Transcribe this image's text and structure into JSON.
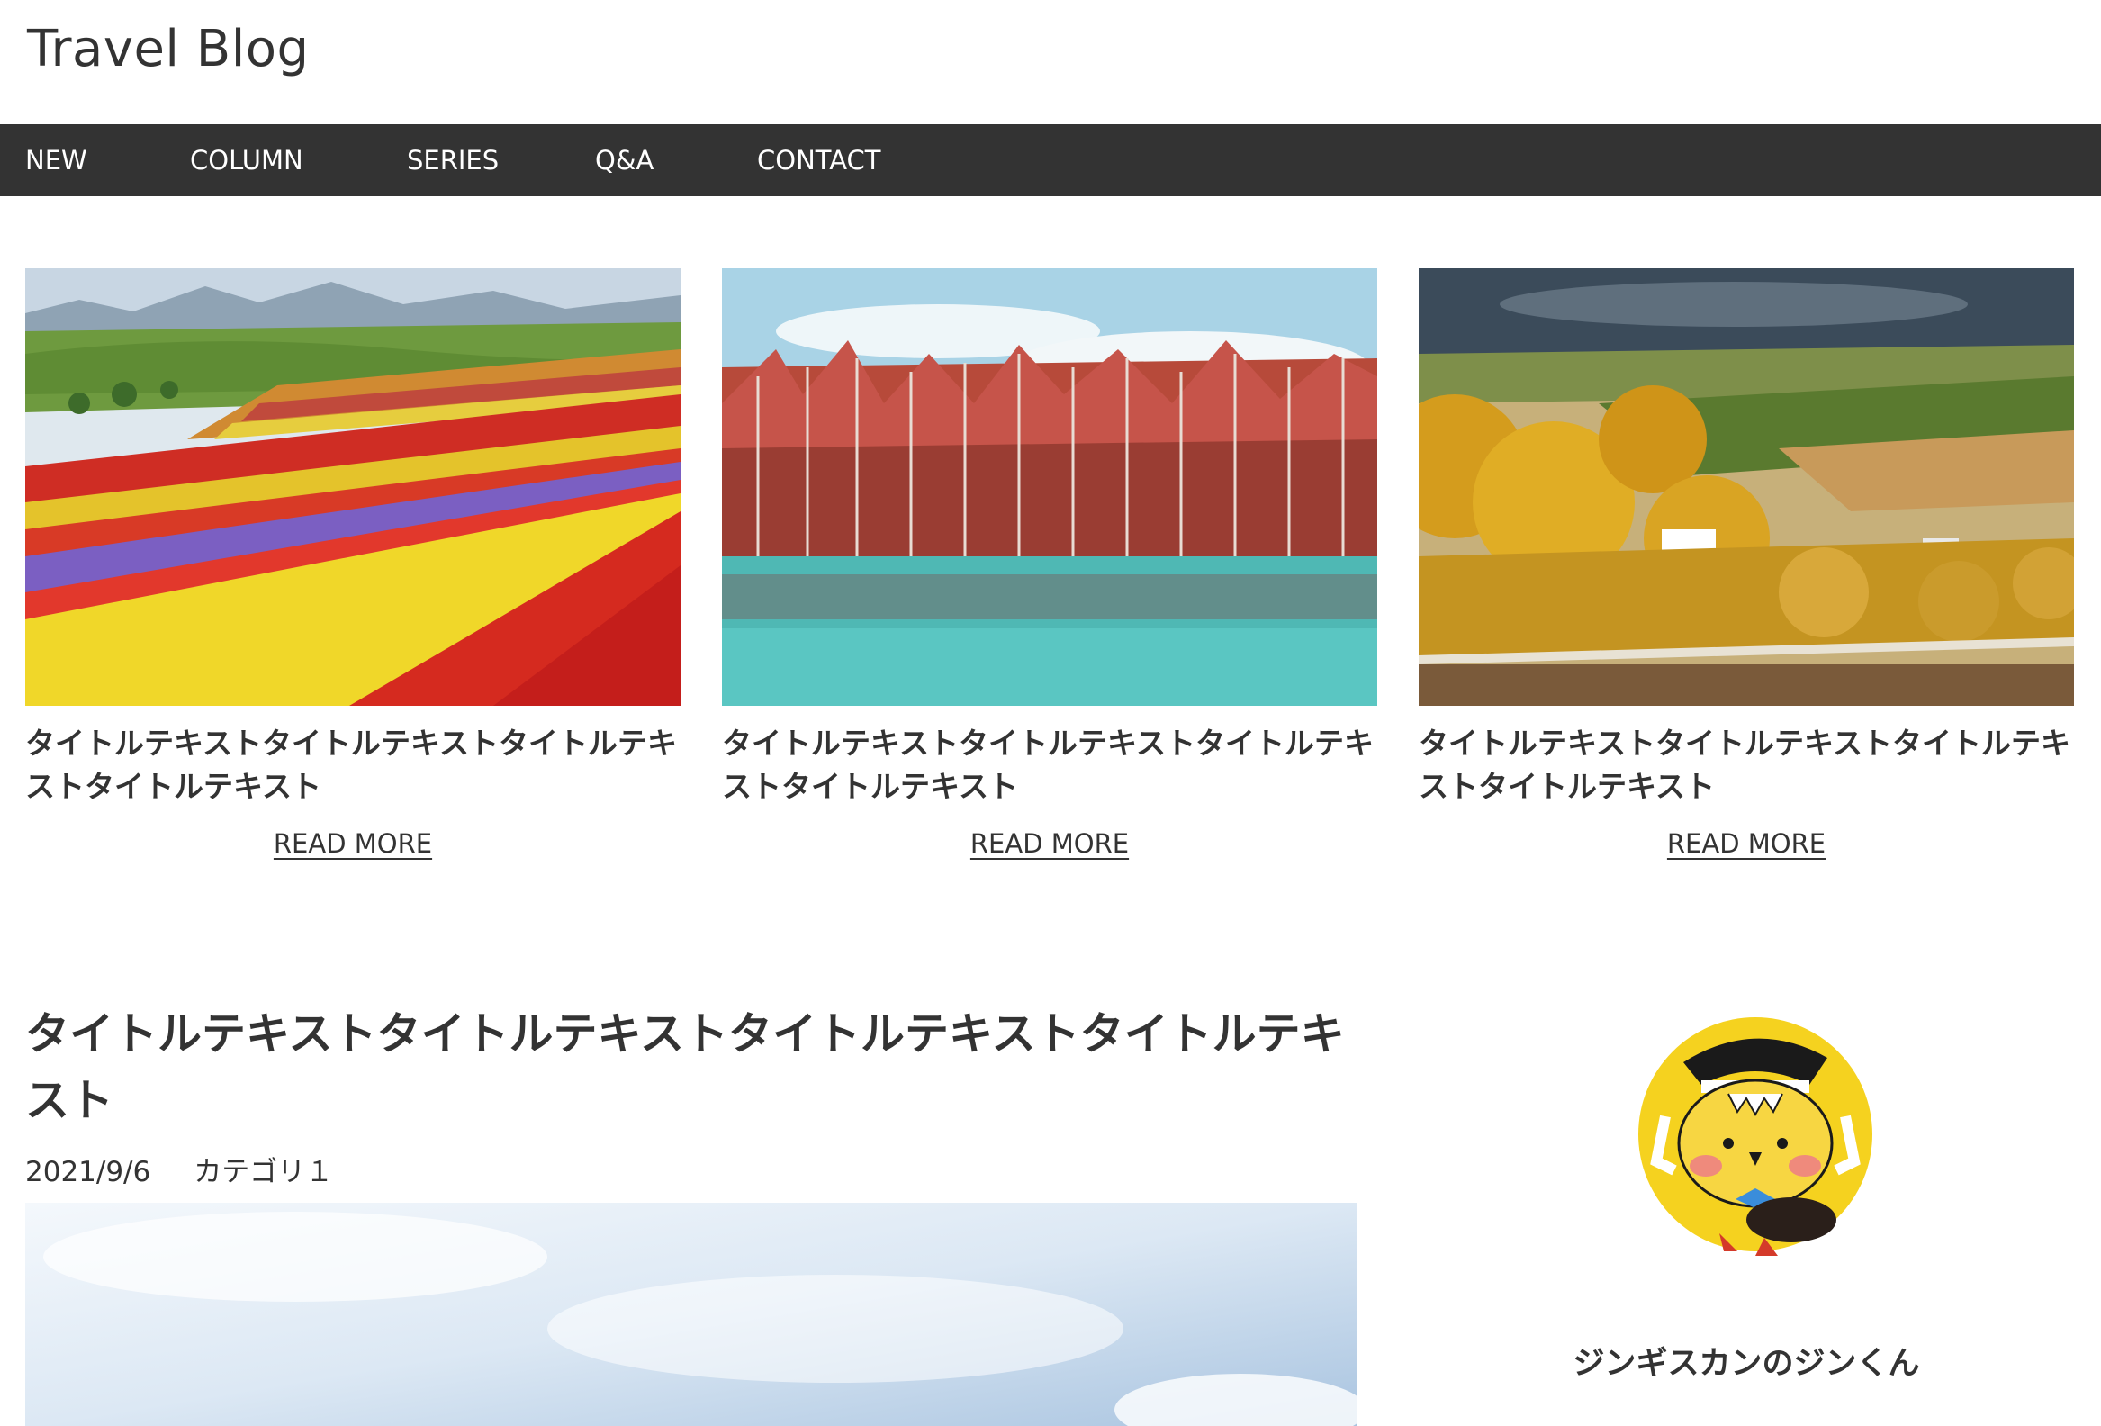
{
  "site": {
    "title": "Travel Blog"
  },
  "nav": [
    {
      "label": "NEW"
    },
    {
      "label": "COLUMN"
    },
    {
      "label": "SERIES"
    },
    {
      "label": "Q&A"
    },
    {
      "label": "CONTACT"
    }
  ],
  "cards": [
    {
      "image": "flower-field-photo",
      "title": "タイトルテキストタイトルテキストタイトルテキストタイトルテキスト",
      "read_more": "READ MORE"
    },
    {
      "image": "blue-pond-red-trees-photo",
      "title": "タイトルテキストタイトルテキストタイトルテキストタイトルテキスト",
      "read_more": "READ MORE"
    },
    {
      "image": "autumn-hills-photo",
      "title": "タイトルテキストタイトルテキストタイトルテキストタイトルテキスト",
      "read_more": "READ MORE"
    }
  ],
  "post": {
    "title": "タイトルテキストタイトルテキストタイトルテキストタイトルテキスト",
    "date": "2021/9/6",
    "category": "カテゴリ１",
    "image": "sky-photo"
  },
  "profile": {
    "avatar": "mascot-avatar",
    "name": "ジンギスカンのジンくん"
  },
  "colors": {
    "nav_bg": "#333333",
    "nav_text": "#ffffff",
    "text": "#333333",
    "avatar_bg": "#f5d21f"
  }
}
